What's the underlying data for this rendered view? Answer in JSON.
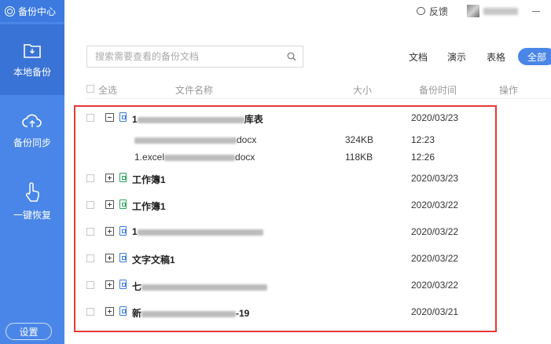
{
  "app": {
    "title": "备份中心"
  },
  "sidebar": {
    "items": [
      {
        "label": "本地备份",
        "icon": "folder-icon"
      },
      {
        "label": "备份同步",
        "icon": "cloud-upload-icon"
      },
      {
        "label": "一键恢复",
        "icon": "tap-hand-icon"
      }
    ],
    "settings_label": "设置"
  },
  "topbar": {
    "feedback_label": "反馈"
  },
  "search": {
    "placeholder": "搜索需要查看的备份文档"
  },
  "filters": {
    "doc": "文档",
    "ppt": "演示",
    "xls": "表格",
    "all": "全部"
  },
  "table": {
    "headers": {
      "select_all": "全选",
      "name": "文件名称",
      "size": "大小",
      "time": "备份时间",
      "action": "操作"
    },
    "rows": [
      {
        "name_prefix": "1",
        "name_suffix": "库表",
        "date": "2020/03/23"
      },
      {
        "name": "工作簿1",
        "date": "2020/03/23"
      },
      {
        "name": "工作簿1",
        "date": "2020/03/22"
      },
      {
        "name_prefix": "1",
        "date": "2020/03/22"
      },
      {
        "name": "文字文稿1",
        "date": "2020/03/22"
      },
      {
        "name_prefix": "七",
        "date": "2020/03/22"
      },
      {
        "name_prefix": "新",
        "name_suffix": "-19",
        "date": "2020/03/21"
      }
    ],
    "subrows": [
      {
        "name_suffix": "docx",
        "size": "324KB",
        "time": "12:23"
      },
      {
        "name_prefix": "1.excel",
        "name_suffix": "docx",
        "size": "118KB",
        "time": "12:26"
      }
    ]
  },
  "colors": {
    "sidebar": "#4a86e8",
    "accent": "#4a86e8",
    "highlight": "#e53935"
  }
}
